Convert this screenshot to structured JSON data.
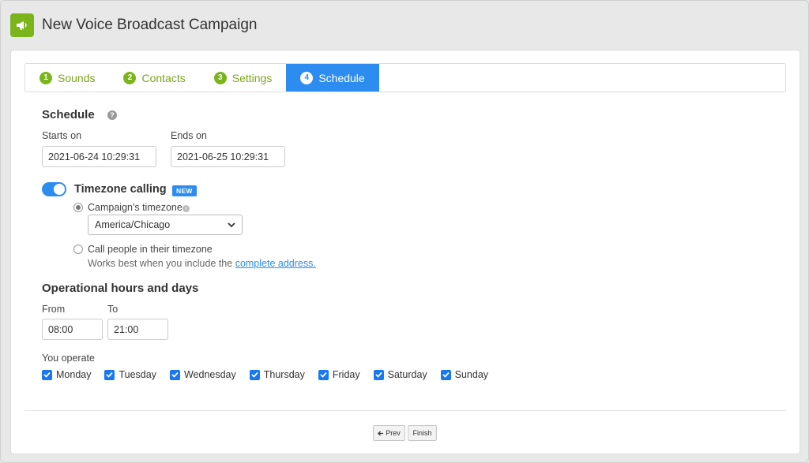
{
  "header": {
    "title": "New Voice Broadcast Campaign",
    "icon": "megaphone-icon",
    "icon_color": "#7bb51b"
  },
  "tabs": [
    {
      "num": "1",
      "label": "Sounds",
      "active": false
    },
    {
      "num": "2",
      "label": "Contacts",
      "active": false
    },
    {
      "num": "3",
      "label": "Settings",
      "active": false
    },
    {
      "num": "4",
      "label": "Schedule",
      "active": true
    }
  ],
  "schedule": {
    "title": "Schedule",
    "starts_label": "Starts on",
    "starts_value": "2021-06-24 10:29:31",
    "ends_label": "Ends on",
    "ends_value": "2021-06-25 10:29:31"
  },
  "timezone": {
    "title": "Timezone calling",
    "badge": "NEW",
    "enabled": true,
    "option_campaign": "Campaign's timezone",
    "selected_timezone": "America/Chicago",
    "option_people": "Call people in their timezone",
    "hint_prefix": "Works best when you include the ",
    "hint_link": "complete address."
  },
  "operational": {
    "title": "Operational hours and days",
    "from_label": "From",
    "from_value": "08:00",
    "to_label": "To",
    "to_value": "21:00",
    "operate_label": "You operate",
    "days": [
      "Monday",
      "Tuesday",
      "Wednesday",
      "Thursday",
      "Friday",
      "Saturday",
      "Sunday"
    ]
  },
  "footer": {
    "prev_label": "Prev",
    "finish_label": "Finish"
  },
  "colors": {
    "accent": "#2c8cf0",
    "brand": "#7bb51b"
  }
}
